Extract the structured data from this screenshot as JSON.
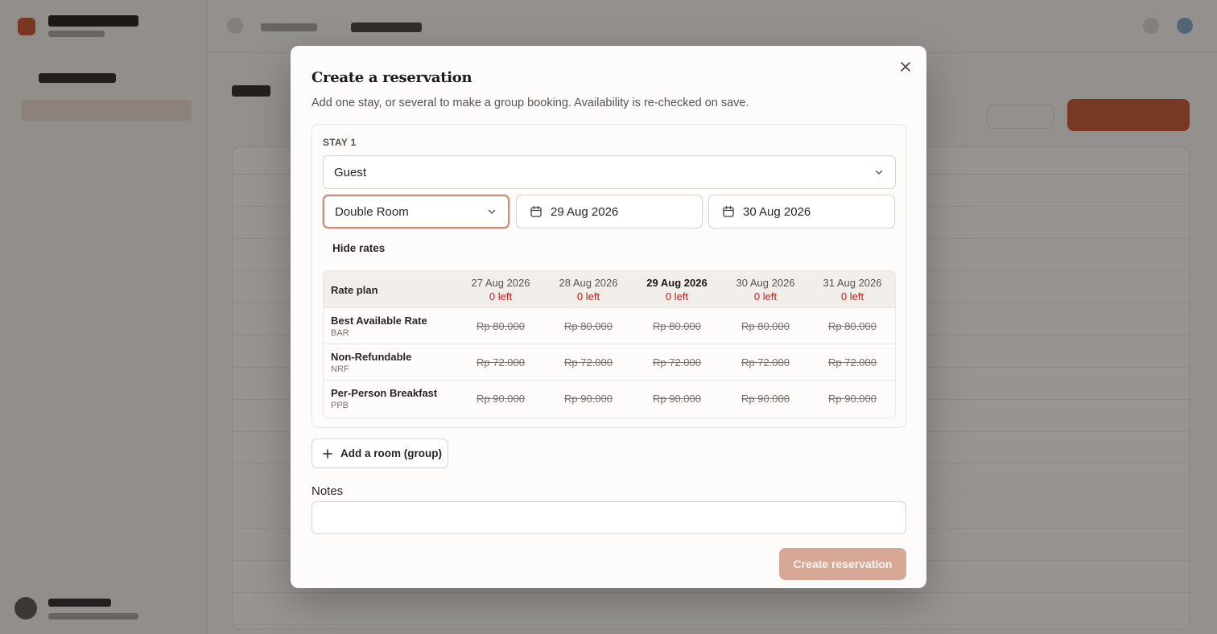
{
  "modal": {
    "title": "Create a reservation",
    "description": "Add one stay, or several to make a group booking. Availability is re-checked on save.",
    "close_icon": "close-icon",
    "stay": {
      "label": "STAY 1",
      "guest_value": "Guest",
      "room_value": "Double Room",
      "check_in": "29 Aug 2026",
      "check_out": "30 Aug 2026",
      "hide_rates_label": "Hide rates"
    },
    "rate_table": {
      "plan_header": "Rate plan",
      "dates": [
        {
          "date": "27 Aug 2026",
          "left": "0 left"
        },
        {
          "date": "28 Aug 2026",
          "left": "0 left"
        },
        {
          "date": "29 Aug 2026",
          "left": "0 left"
        },
        {
          "date": "30 Aug 2026",
          "left": "0 left"
        },
        {
          "date": "31 Aug 2026",
          "left": "0 left"
        }
      ],
      "selected_date_index": 2,
      "plans": [
        {
          "name": "Best Available Rate",
          "code": "BAR",
          "prices": [
            "Rp 80.000",
            "Rp 80.000",
            "Rp 80.000",
            "Rp 80.000",
            "Rp 80.000"
          ]
        },
        {
          "name": "Non-Refundable",
          "code": "NRF",
          "prices": [
            "Rp 72.000",
            "Rp 72.000",
            "Rp 72.000",
            "Rp 72.000",
            "Rp 72.000"
          ]
        },
        {
          "name": "Per-Person Breakfast",
          "code": "PPB",
          "prices": [
            "Rp 90.000",
            "Rp 90.000",
            "Rp 90.000",
            "Rp 90.000",
            "Rp 90.000"
          ]
        }
      ]
    },
    "add_room_label": "Add a room (group)",
    "notes_label": "Notes",
    "notes_value": "",
    "submit_label": "Create reservation"
  },
  "colors": {
    "accent": "#c4532f",
    "availability_red": "#b91c1c",
    "submit_disabled": "#d8a897"
  }
}
